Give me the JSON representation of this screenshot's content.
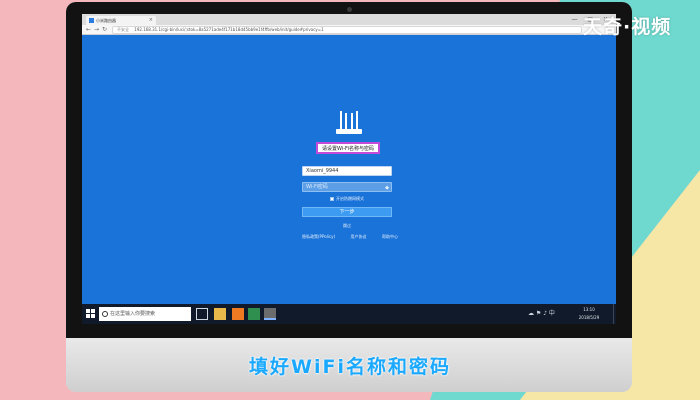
{
  "watermark": "天奇·视频",
  "browser": {
    "tab_title": "小米路由器",
    "address_secure": "不安全",
    "url": "192.168.31.1/cgi-bin/luci/;stok=8a5271ade4f171b18d45bb9e1f4ffb/web/init/guide#privacy=1",
    "window_controls": "— ▢ ✕"
  },
  "page": {
    "title": "请设置Wi-Fi名称与密码",
    "wifi_name_value": "Xiaomi_9944",
    "wifi_password_placeholder": "Wi-Fi密码",
    "checkbox_label": "开启防蹭网模式",
    "next_button": "下一步",
    "skip_link": "跳过",
    "footer": [
      "隐私政策(PPolicy)",
      "用户协议",
      "帮助中心"
    ]
  },
  "taskbar": {
    "search_placeholder": "在这里输入你要搜索",
    "clock_time": "13:10",
    "clock_date": "2018/5/29",
    "tray_text": "☁ ⚑ ♪ 中"
  },
  "caption": "填好WiFi名称和密码",
  "colors": {
    "screen_bg": "#1a73d9",
    "highlight_border": "#c24bd8",
    "caption": "#1aa9ff"
  }
}
